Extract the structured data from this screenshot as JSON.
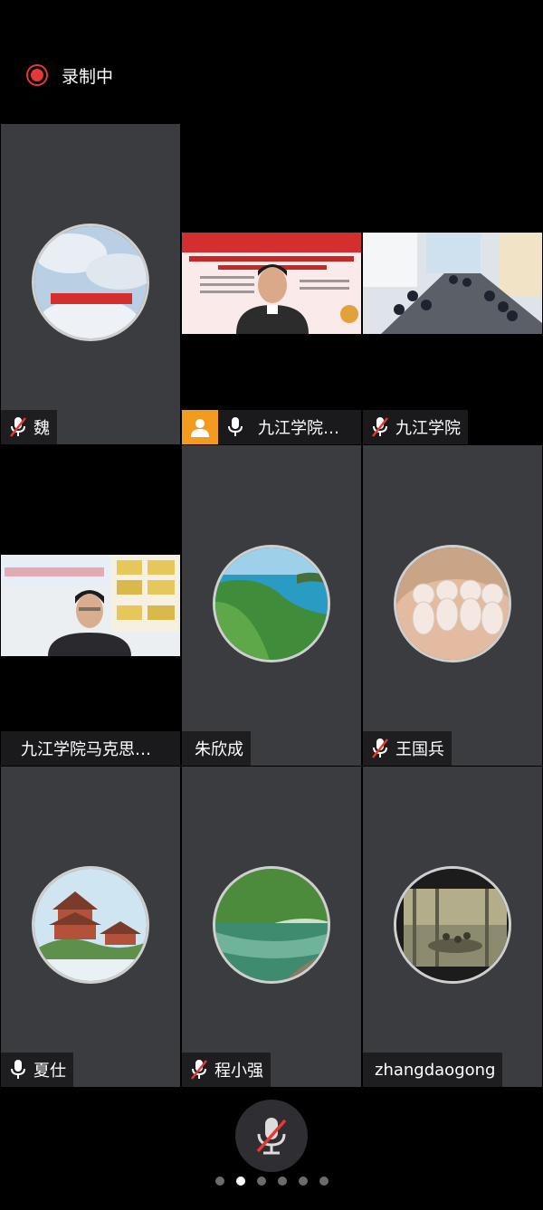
{
  "recording": {
    "label": "录制中"
  },
  "participants": [
    {
      "name": "魏",
      "muted": true
    },
    {
      "name": "九江学院…",
      "muted": false
    },
    {
      "name": "九江学院",
      "muted": true
    },
    {
      "name": "九江学院马克思…"
    },
    {
      "name": "朱欣成"
    },
    {
      "name": "王国兵",
      "muted": true
    },
    {
      "name": "夏仕",
      "muted": false
    },
    {
      "name": "程小强",
      "muted": true
    },
    {
      "name": "zhangdaogong"
    }
  ],
  "pager": {
    "pages": 6,
    "active_page": 2
  },
  "colors": {
    "recording_dot": "#e53935",
    "tile_bg": "#3b3c40",
    "host_badge": "#f29b1f",
    "muted_slash": "#e53935"
  }
}
